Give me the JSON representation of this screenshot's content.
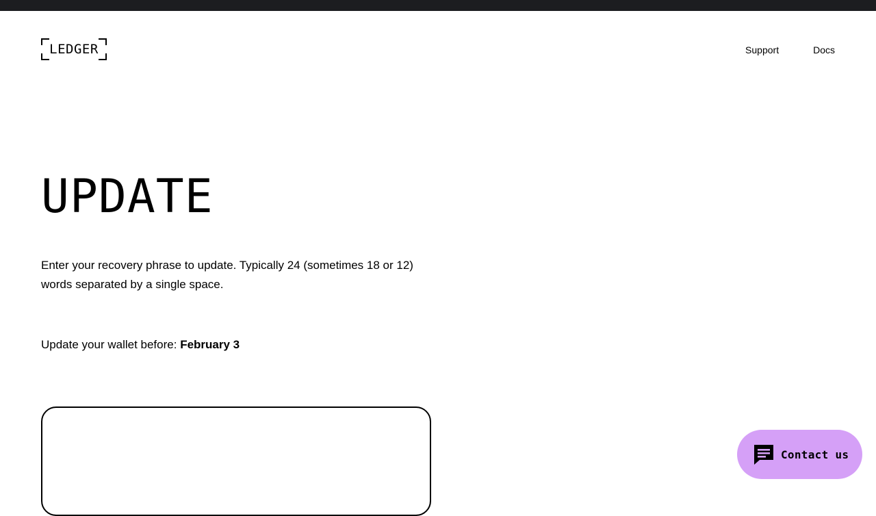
{
  "header": {
    "logo_text": "LEDGER",
    "nav": [
      {
        "label": "Support"
      },
      {
        "label": "Docs"
      }
    ]
  },
  "main": {
    "title": "UPDATE",
    "intro": "Enter your recovery phrase to update. Typically 24 (sometimes 18 or 12) words separated by a single space.",
    "deadline_label": "Update your wallet before:",
    "deadline_date": "February 3",
    "phrase_input": {
      "value": "",
      "placeholder": ""
    }
  },
  "contact_button": {
    "label": "Contact us",
    "icon": "chat-icon"
  },
  "colors": {
    "topbar": "#1c1d20",
    "contact_bg": "#d5a0f7",
    "text": "#000000",
    "background": "#ffffff"
  }
}
